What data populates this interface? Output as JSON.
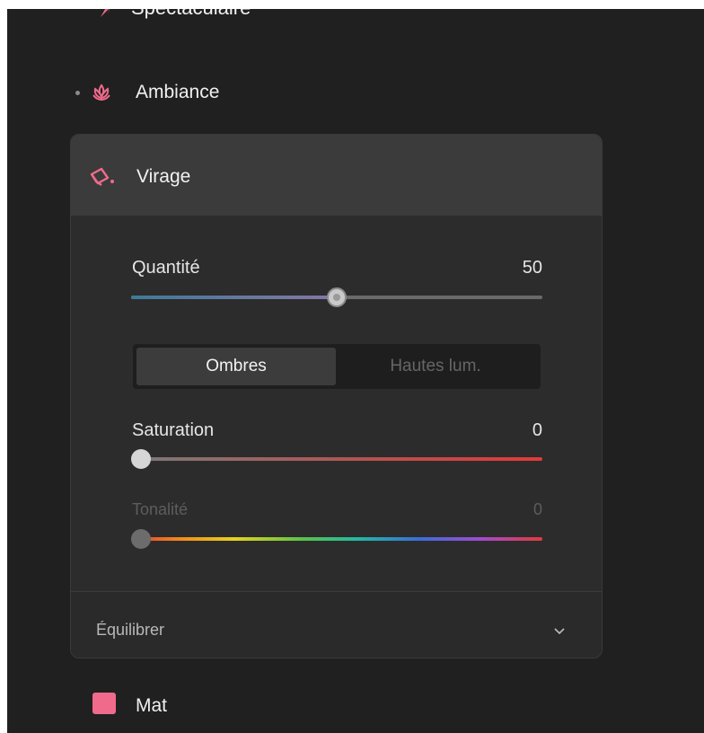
{
  "nav": {
    "top_partial_label": "Spectaculaire",
    "ambiance_label": "Ambiance",
    "mat_label": "Mat"
  },
  "card": {
    "title": "Virage",
    "quantite": {
      "label": "Quantité",
      "value": "50",
      "fraction": 0.5
    },
    "toggle": {
      "active": "Ombres",
      "inactive": "Hautes lum."
    },
    "saturation": {
      "label": "Saturation",
      "value": "0",
      "fraction": 0.0
    },
    "tonalite": {
      "label": "Tonalité",
      "value": "0",
      "fraction": 0.0
    },
    "footer_label": "Équilibrer"
  },
  "colors": {
    "accent": "#f06a8c",
    "background": "#202020",
    "card": "#2c2c2c"
  },
  "icons": {
    "top": "spark-icon",
    "ambiance": "lotus-icon",
    "virage": "paint-bucket-icon",
    "footer": "chevron-down-icon"
  }
}
